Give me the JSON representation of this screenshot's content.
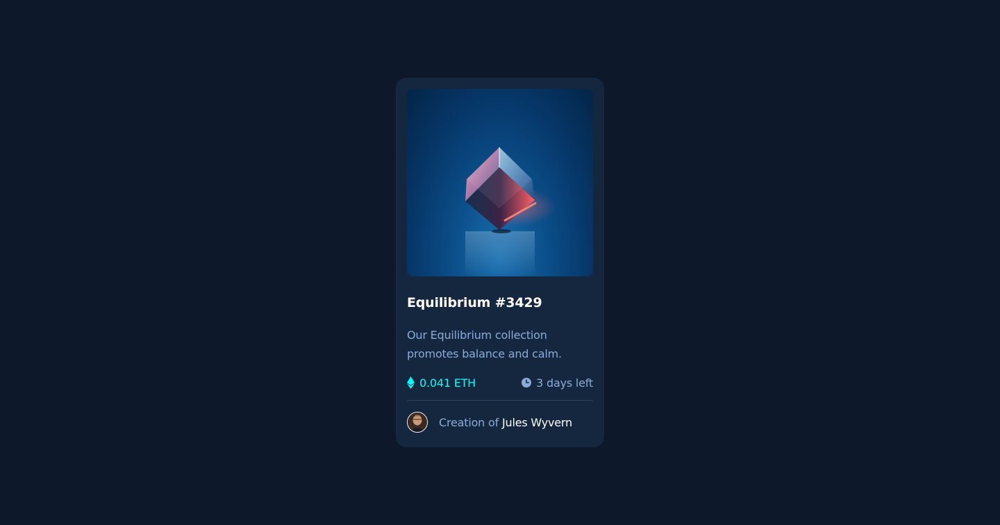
{
  "card": {
    "image_alt": "Equilibrium crystal cube",
    "title": "Equilibrium #3429",
    "description_line1": "Our Equilibrium collection",
    "description_line2": "promotes balance and calm.",
    "price": "0.041 ETH",
    "time_left": "3 days left",
    "creator_prefix": "Creation of",
    "creator_name": "Jules Wyvern"
  },
  "icons": {
    "price": "ethereum-icon",
    "time": "clock-icon"
  },
  "colors": {
    "page_bg": "#0d192b",
    "card_bg": "#15263f",
    "accent_cyan": "#00fff8",
    "soft_blue": "#8bacd9",
    "white": "#ffffff"
  }
}
